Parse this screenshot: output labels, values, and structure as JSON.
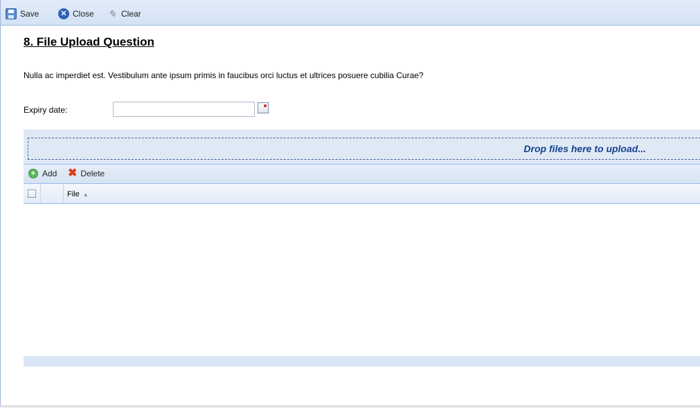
{
  "toolbar": {
    "save_label": "Save",
    "close_label": "Close",
    "clear_label": "Clear"
  },
  "question": {
    "title": "8. File Upload Question",
    "description": "Nulla ac imperdiet est. Vestibulum ante ipsum primis in faucibus orci luctus et ultrices posuere cubilia Curae?"
  },
  "expiry": {
    "label": "Expiry date:",
    "value": ""
  },
  "upload": {
    "drop_text": "Drop files here to upload...",
    "add_label": "Add",
    "delete_label": "Delete",
    "columns": [
      "File"
    ],
    "rows": []
  },
  "icons": {
    "save": "save-icon",
    "close": "close-icon",
    "clear": "clear-icon",
    "add": "add-icon",
    "delete": "delete-icon",
    "calendar": "calendar-icon",
    "sort": "sort-ascending-icon"
  },
  "colors": {
    "toolbar_bg": "#d3e2f5",
    "drop_text": "#15428b",
    "panel_bg": "#dfe9f6"
  }
}
